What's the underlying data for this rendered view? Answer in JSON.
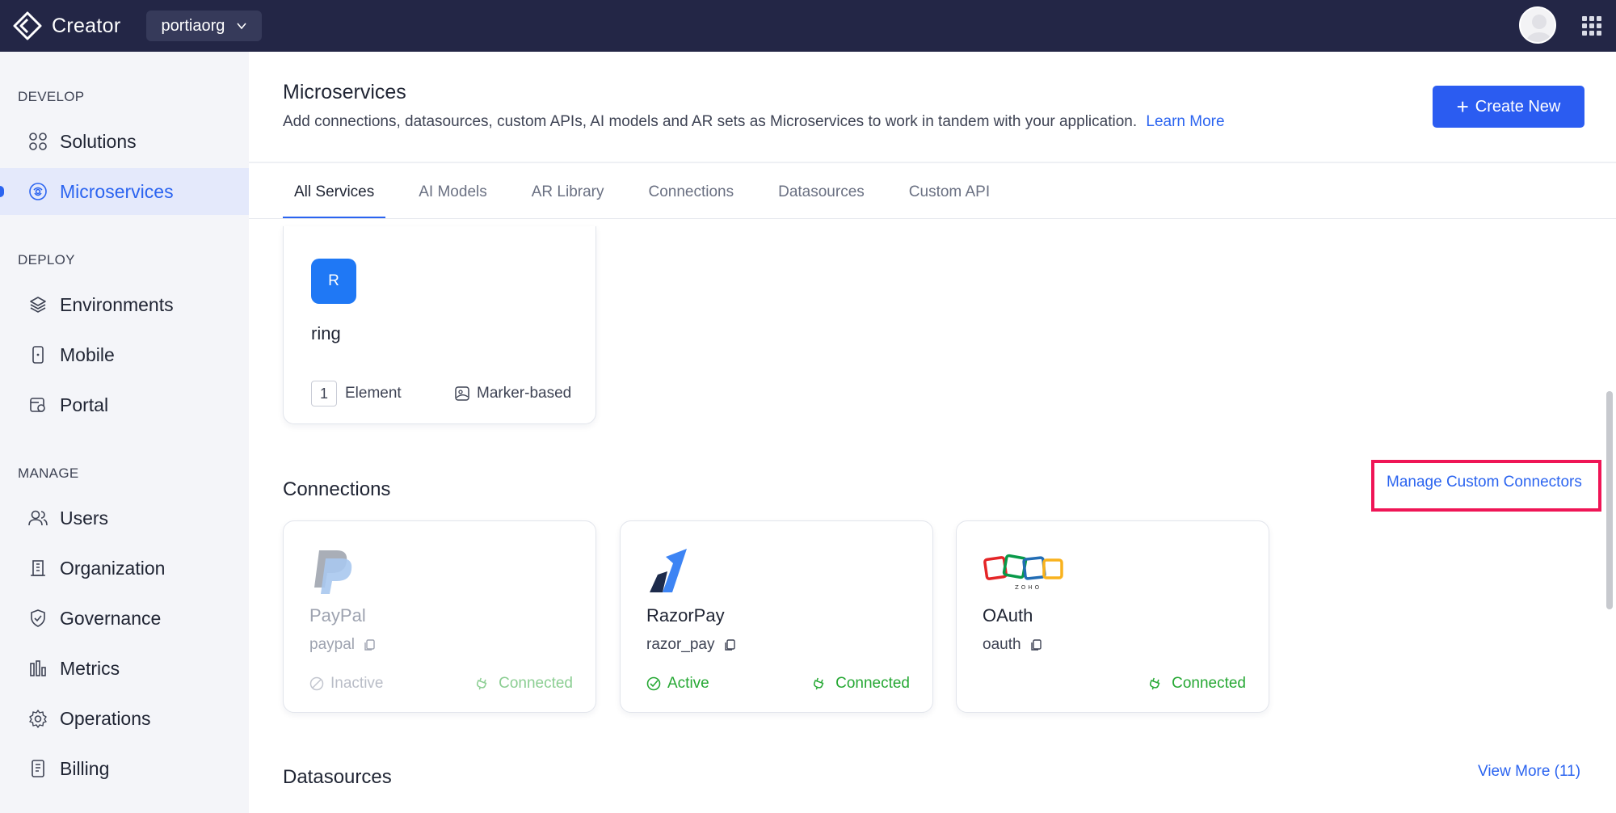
{
  "app": {
    "name": "Creator",
    "org": "portiaorg"
  },
  "sidebar": {
    "groups": [
      {
        "label": "DEVELOP"
      },
      {
        "label": "DEPLOY"
      },
      {
        "label": "MANAGE"
      }
    ],
    "items": [
      {
        "label": "Solutions",
        "icon": "grid-icon"
      },
      {
        "label": "Microservices",
        "icon": "microservices-icon"
      },
      {
        "label": "Environments",
        "icon": "layers-icon"
      },
      {
        "label": "Mobile",
        "icon": "mobile-icon"
      },
      {
        "label": "Portal",
        "icon": "portal-icon"
      },
      {
        "label": "Users",
        "icon": "users-icon"
      },
      {
        "label": "Organization",
        "icon": "building-icon"
      },
      {
        "label": "Governance",
        "icon": "shield-icon"
      },
      {
        "label": "Metrics",
        "icon": "bar-chart-icon"
      },
      {
        "label": "Operations",
        "icon": "gear-icon"
      },
      {
        "label": "Billing",
        "icon": "receipt-icon"
      }
    ]
  },
  "header": {
    "title": "Microservices",
    "description": "Add connections, datasources, custom APIs, AI models and AR sets as Microservices to work in tandem with your application.",
    "learn_more": "Learn More",
    "create_button": "Create New"
  },
  "tabs": [
    {
      "label": "All Services"
    },
    {
      "label": "AI Models"
    },
    {
      "label": "AR Library"
    },
    {
      "label": "Connections"
    },
    {
      "label": "Datasources"
    },
    {
      "label": "Custom API"
    }
  ],
  "ar_card": {
    "badge": "R",
    "name": "ring",
    "count": "1",
    "count_label": "Element",
    "type": "Marker-based"
  },
  "connections": {
    "title": "Connections",
    "manage_link": "Manage Custom Connectors",
    "cards": [
      {
        "name": "PayPal",
        "code": "paypal",
        "status": "Inactive",
        "connection": "Connected"
      },
      {
        "name": "RazorPay",
        "code": "razor_pay",
        "status": "Active",
        "connection": "Connected"
      },
      {
        "name": "OAuth",
        "code": "oauth",
        "status": "",
        "connection": "Connected"
      }
    ]
  },
  "datasources": {
    "title": "Datasources",
    "view_more": "View More (11)"
  },
  "colors": {
    "topbar": "#232646",
    "accent": "#2b64f0",
    "success": "#26a834",
    "highlight": "#ef1556"
  }
}
